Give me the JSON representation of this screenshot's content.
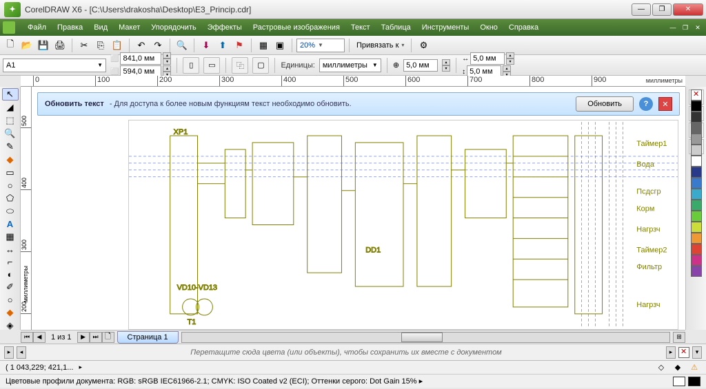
{
  "title": "CorelDRAW X6 - [C:\\Users\\drakosha\\Desktop\\E3_Princip.cdr]",
  "menu": [
    "Файл",
    "Правка",
    "Вид",
    "Макет",
    "Упорядочить",
    "Эффекты",
    "Растровые изображения",
    "Текст",
    "Таблица",
    "Инструменты",
    "Окно",
    "Справка"
  ],
  "zoom": "20%",
  "snap_label": "Привязать к",
  "prop": {
    "paper_preset": "A1",
    "width": "841,0 мм",
    "height": "594,0 мм",
    "units_label": "Единицы:",
    "units_value": "миллиметры",
    "nudge": "5,0 мм",
    "dup_x": "5,0 мм",
    "dup_y": "5,0 мм"
  },
  "ruler_h": [
    "0",
    "100",
    "200",
    "300",
    "400",
    "500",
    "600",
    "700",
    "800",
    "900"
  ],
  "ruler_h_unit": "миллиметры",
  "ruler_v": [
    "200",
    "300",
    "400",
    "500"
  ],
  "ruler_v_unit": "миллиметры",
  "notice": {
    "title": "Обновить текст",
    "text": " -  Для доступа к более новым функциям текст необходимо обновить.",
    "button": "Обновить"
  },
  "pager": {
    "info": "1 из 1",
    "tab": "Страница 1"
  },
  "palette_hint": "Перетащите сюда цвета (или объекты), чтобы сохранить их вместе с документом",
  "status": {
    "coords": "( 1 043,229; 421,1...",
    "profiles": "Цветовые профили документа: RGB: sRGB IEC61966-2.1; CMYK: ISO Coated v2 (ECI); Оттенки серого: Dot Gain 15% ▸"
  },
  "colors": [
    "#ffffff",
    "#000000",
    "#2a3a6a",
    "#2a6aaa",
    "#2a9a9a",
    "#2a9a4a",
    "#8aaa3a",
    "#d8c040",
    "#d88030",
    "#c04030",
    "#a03060",
    "#7040a0"
  ],
  "schematic_labels": [
    "Таймер1",
    "Вода",
    "Псдсгр",
    "Корм",
    "Нагрзч",
    "Таймер2",
    "Фильтр",
    "Нагрзч"
  ]
}
